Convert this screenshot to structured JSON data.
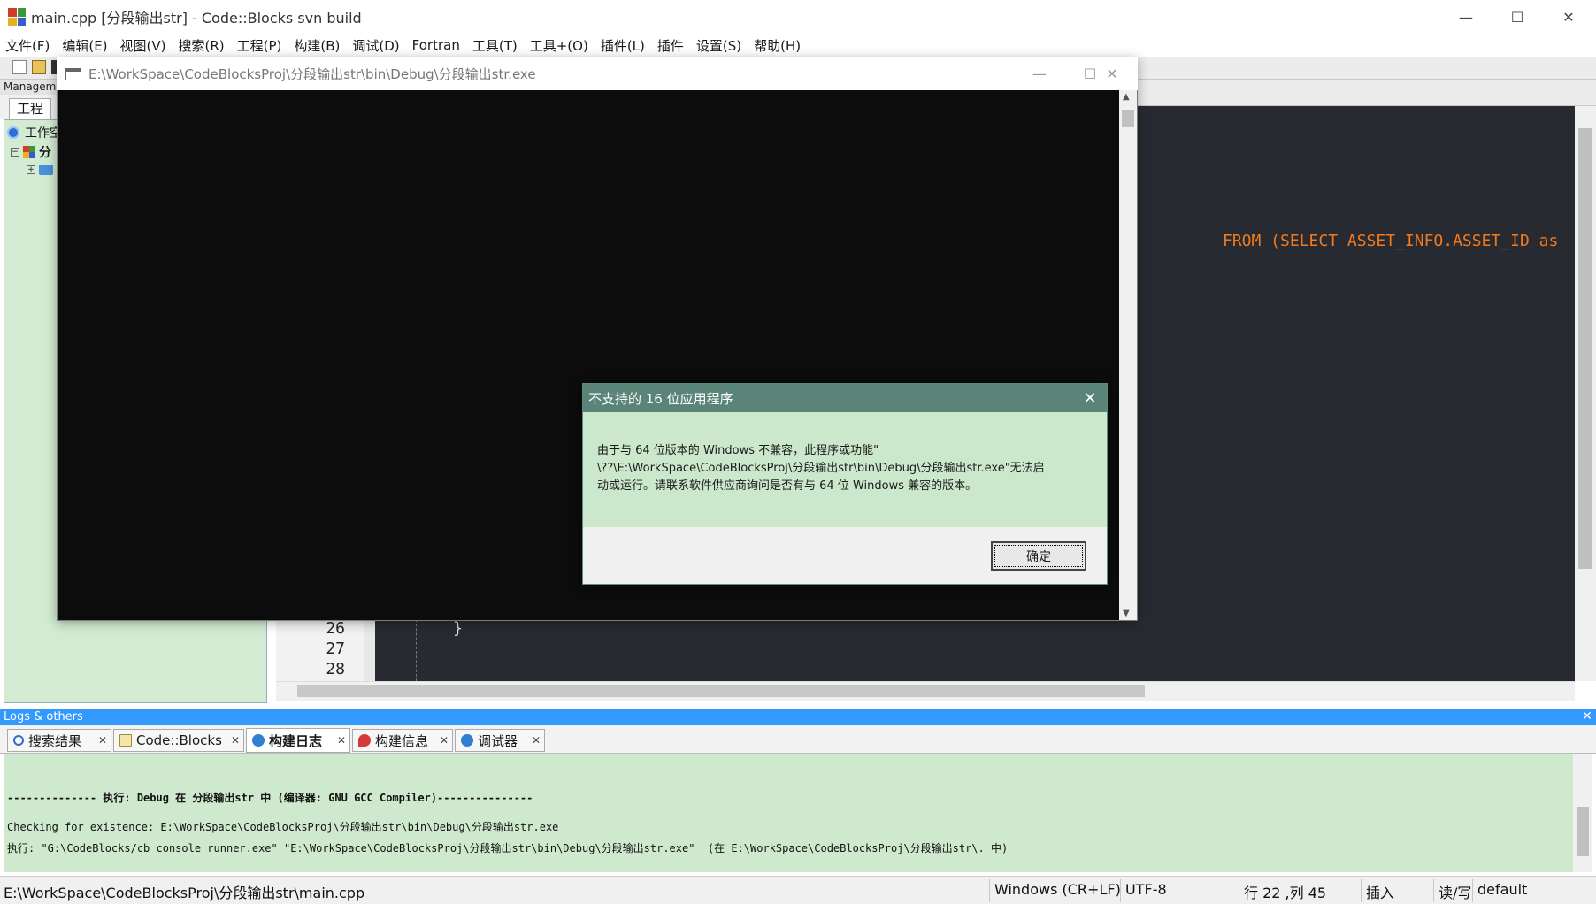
{
  "window": {
    "title": "main.cpp [分段输出str] - Code::Blocks svn build",
    "minimize": "—",
    "maximize": "☐",
    "close": "✕"
  },
  "menu": [
    "文件(F)",
    "编辑(E)",
    "视图(V)",
    "搜索(R)",
    "工程(P)",
    "构建(B)",
    "调试(D)",
    "Fortran",
    "工具(T)",
    "工具+(O)",
    "插件(L)",
    "插件",
    "设置(S)",
    "帮助(H)"
  ],
  "management": {
    "header": "Manageme",
    "tab_project": "工程",
    "tree": {
      "workspace": "工作空",
      "project": "分"
    }
  },
  "editor": {
    "code_from": "FROM (SELECT ASSET_INFO.ASSET_ID as",
    "code_brace": "}",
    "line_numbers": [
      "26",
      "27",
      "28"
    ]
  },
  "console": {
    "title": "E:\\WorkSpace\\CodeBlocksProj\\分段输出str\\bin\\Debug\\分段输出str.exe",
    "minimize": "—",
    "maximize": "☐",
    "close": "✕",
    "scroll_up": "▲",
    "scroll_down": "▼"
  },
  "dialog": {
    "title": "不支持的 16 位应用程序",
    "close": "✕",
    "message_line1": "由于与 64 位版本的 Windows 不兼容，此程序或功能\"",
    "message_line2": "\\??\\E:\\WorkSpace\\CodeBlocksProj\\分段输出str\\bin\\Debug\\分段输出str.exe\"无法启",
    "message_line3": "动或运行。请联系软件供应商询问是否有与 64 位 Windows 兼容的版本。",
    "ok_label": "确定"
  },
  "logs": {
    "header": "Logs & others",
    "close": "✕",
    "tabs": [
      {
        "label": "搜索结果",
        "icon": "search-icon"
      },
      {
        "label": "Code::Blocks",
        "icon": "note-icon"
      },
      {
        "label": "构建日志",
        "icon": "gear-icon"
      },
      {
        "label": "构建信息",
        "icon": "pin-icon"
      },
      {
        "label": "调试器",
        "icon": "gear-icon"
      }
    ],
    "active_tab": "构建日志",
    "tab_close": "✕",
    "lines": [
      "-------------- 执行: Debug 在 分段输出str 中 (编译器: GNU GCC Compiler)---------------",
      "Checking for existence: E:\\WorkSpace\\CodeBlocksProj\\分段输出str\\bin\\Debug\\分段输出str.exe",
      "执行: \"G:\\CodeBlocks/cb_console_runner.exe\" \"E:\\WorkSpace\\CodeBlocksProj\\分段输出str\\bin\\Debug\\分段输出str.exe\"  (在 E:\\WorkSpace\\CodeBlocksProj\\分段输出str\\. 中)"
    ]
  },
  "status": {
    "file_path": "E:\\WorkSpace\\CodeBlocksProj\\分段输出str\\main.cpp",
    "eol": "Windows (CR+LF)",
    "encoding": "UTF-8",
    "position": "行 22 ,列 45",
    "mode": "插入",
    "access": "读/写",
    "profile": "default"
  },
  "colors": {
    "accent": "#3399ff",
    "dialog_title": "#5b8478",
    "panel_green": "#cfe9cf",
    "code_keyword": "#f07a1e"
  }
}
